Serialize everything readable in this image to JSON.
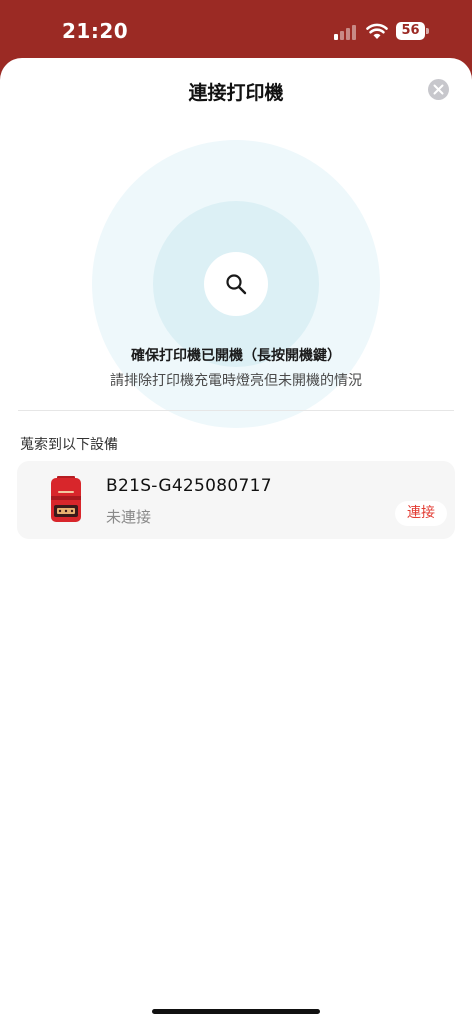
{
  "status_bar": {
    "time": "21:20",
    "signal_bars_active": 1,
    "battery_level": "56",
    "icons": [
      "signal-icon",
      "wifi-icon",
      "battery-icon"
    ]
  },
  "sheet": {
    "title": "連接打印機",
    "close_icon": "close-icon"
  },
  "scan": {
    "icon": "search-icon",
    "hint_title": "確保打印機已開機（長按開機鍵）",
    "hint_subtitle": "請排除打印機充電時燈亮但未開機的情況"
  },
  "devices": {
    "section_label": "蒐索到以下設備",
    "items": [
      {
        "name": "B21S-G425080717",
        "status": "未連接",
        "action_label": "連接",
        "icon": "printer-icon"
      }
    ]
  },
  "colors": {
    "accent": "#e23b32",
    "header_bg": "#9b2a24",
    "scan_outer": "#eef8fb",
    "scan_inner": "#dcf0f5",
    "printer_body": "#d8262b"
  }
}
